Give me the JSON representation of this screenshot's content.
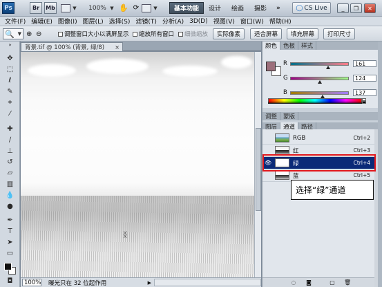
{
  "appbar": {
    "app_logo": "Ps",
    "bridge_logo": "Br",
    "minibridge_logo": "Mb",
    "zoom": "100%",
    "workspaces": [
      "基本功能",
      "设计",
      "绘画",
      "摄影"
    ],
    "more": "»",
    "cs_live": "CS Live",
    "win_minimize": "_",
    "win_restore": "❐",
    "win_close": "✕"
  },
  "menu": [
    "文件(F)",
    "编辑(E)",
    "图像(I)",
    "图层(L)",
    "选择(S)",
    "滤镜(T)",
    "分析(A)",
    "3D(D)",
    "视图(V)",
    "窗口(W)",
    "帮助(H)"
  ],
  "options": {
    "resize_windows": "调整窗口大小以满屏显示",
    "zoom_all_windows": "缩放所有窗口",
    "scrubby_zoom": "细微缩放",
    "actual_pixels": "实际像素",
    "fit_screen": "适合屏幕",
    "fill_screen": "填充屏幕",
    "print_size": "打印尺寸"
  },
  "document": {
    "tab_title": "背景.tif @ 100% (背景, 绿/8)",
    "tab_close": "×",
    "zoom": "100%",
    "status": "曝光只在 32 位起作用"
  },
  "color_panel": {
    "tabs": [
      "颜色",
      "色板",
      "样式"
    ],
    "channels": [
      {
        "label": "R",
        "value": "161",
        "fraction": 0.63
      },
      {
        "label": "G",
        "value": "124",
        "fraction": 0.49
      },
      {
        "label": "B",
        "value": "137",
        "fraction": 0.54
      }
    ],
    "foreground": "#9c6f7b",
    "background": "#ffffff"
  },
  "adjust_tabs": [
    "调整",
    "蒙版"
  ],
  "channels_panel": {
    "tabs": [
      "图层",
      "通道",
      "路径"
    ],
    "rows": [
      {
        "name": "RGB",
        "shortcut": "Ctrl+2",
        "eye": "",
        "selected": false
      },
      {
        "name": "红",
        "shortcut": "Ctrl+3",
        "eye": "",
        "selected": false
      },
      {
        "name": "绿",
        "shortcut": "Ctrl+4",
        "eye": "👁",
        "selected": true
      },
      {
        "name": "蓝",
        "shortcut": "Ctrl+5",
        "eye": "",
        "selected": false
      }
    ]
  },
  "callout": "选择“绿”通道",
  "colors": {
    "selection": "#0a2a78",
    "highlight": "#e2171c",
    "active_workspace": "#4b5a6a"
  }
}
